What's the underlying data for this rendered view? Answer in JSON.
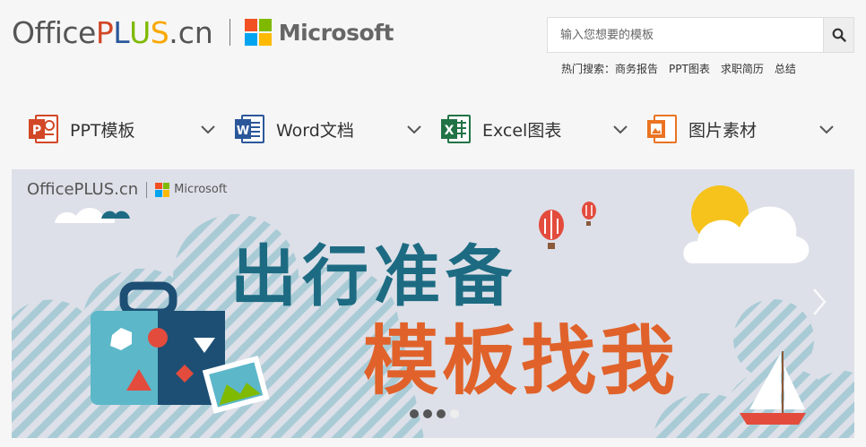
{
  "header": {
    "logo_office": "Office",
    "logo_p": "P",
    "logo_l": "L",
    "logo_u": "U",
    "logo_s": "S",
    "logo_cn": ".cn",
    "brand": "Microsoft"
  },
  "search": {
    "placeholder": "输入您想要的模板"
  },
  "hot_search": {
    "label": "热门搜索：",
    "items": [
      "商务报告",
      "PPT图表",
      "求职简历",
      "总结"
    ]
  },
  "nav": [
    {
      "label": "PPT模板",
      "icon": "powerpoint-icon",
      "color": "#d24726",
      "letter": "P"
    },
    {
      "label": "Word文档",
      "icon": "word-icon",
      "color": "#2b579a",
      "letter": "W"
    },
    {
      "label": "Excel图表",
      "icon": "excel-icon",
      "color": "#217346",
      "letter": "X"
    },
    {
      "label": "图片素材",
      "icon": "picture-icon",
      "color": "#ea7422",
      "letter": ""
    }
  ],
  "banner": {
    "logo_text": "OfficePLUS.cn",
    "logo_ms": "Microsoft",
    "title_line1": "出行准备",
    "title_line2": "模板找我",
    "slides_total": 4,
    "slide_active": 3
  },
  "colors": {
    "teal": "#1d6b82",
    "orange": "#e0622a",
    "banner_bg": "#dde0e8"
  }
}
